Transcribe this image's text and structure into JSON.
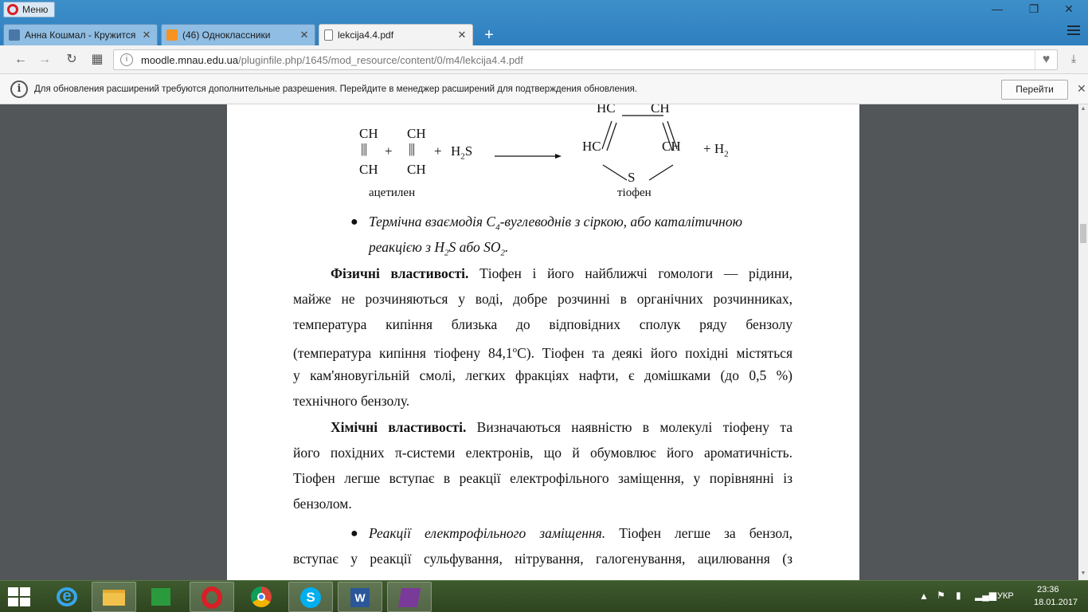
{
  "browser": {
    "menu_label": "Меню",
    "tabs": [
      {
        "title": "Анна Кошмал - Кружится",
        "icon": "vk-icon",
        "active": false
      },
      {
        "title": "(46) Одноклассники",
        "icon": "odnoklassniki-icon",
        "active": false
      },
      {
        "title": "lekcija4.4.pdf",
        "icon": "document-icon",
        "active": true
      }
    ],
    "new_tab": "+",
    "url_host": "moodle.mnau.edu.ua",
    "url_path": "/pluginfile.php/1645/mod_resource/content/0/m4/lekcija4.4.pdf"
  },
  "infobar": {
    "message": "Для обновления расширений требуются дополнительные разрешения. Перейдите в менеджер расширений для подтверждения обновления.",
    "button_label": "Перейти"
  },
  "document": {
    "reaction": {
      "ch": "CH",
      "triple": "|||",
      "plus": "+",
      "h2s_h": "H",
      "h2s_2": "2",
      "h2s_s": "S",
      "hc": "HC",
      "s": "S",
      "h2_prefix": "+ H",
      "h2_sub": "2",
      "label_acetylene": "ацетилен",
      "label_thiophene": "тіофен"
    },
    "bullet1": {
      "p1": "Термічна взаємодія C",
      "sub1": "4",
      "p2": "-вуглеводнів з сіркою, або каталітичною",
      "p3": "реакцією з H",
      "sub2": "2",
      "p4": "S або SO",
      "sub3": "2",
      "p5": "."
    },
    "physical": {
      "heading": "Фізичні властивості.",
      "l1": "Тіофен і його найближчі гомологи — рідини,",
      "l2": "майже не розчиняються у воді, добре розчинні в органічних розчинниках,",
      "l3": "температура кипіння близька до відповідних сполук ряду бензолу",
      "l4a": "(температура кипіння тіофену 84,1",
      "l4sup": "о",
      "l4b": "С). Тіофен та деякі його похідні містяться",
      "l5": "у кам'яновугільній смолі, легких фракціях нафти, є домішками (до 0,5 %)",
      "l6": "технічного бензолу."
    },
    "chemical": {
      "heading": "Хімічні властивості.",
      "l1": "Визначаються наявністю в молекулі тіофену та",
      "l2": "його похідних π-системи електронів, що й обумовлює його ароматичність.",
      "l3": "Тіофен легше вступає в реакції електрофільного заміщення, у порівнянні із",
      "l4": "бензолом."
    },
    "bullet2": {
      "italic": "Реакції електрофільного заміщення.",
      "l1": "Тіофен легше за бензол,",
      "l2": "вступає у реакції сульфування, нітрування, галогенування, ацилювання (з"
    }
  },
  "taskbar": {
    "apps": [
      "internet-explorer-icon",
      "file-explorer-icon",
      "store-icon",
      "opera-icon",
      "chrome-icon",
      "skype-icon",
      "word-icon",
      "onenote-icon"
    ],
    "lang": "УКР",
    "time": "23:36",
    "date": "18.01.2017"
  },
  "colors": {
    "titlebar": "#2f7fbf",
    "opera_red": "#d81f26",
    "taskbar": "#2e4520"
  }
}
